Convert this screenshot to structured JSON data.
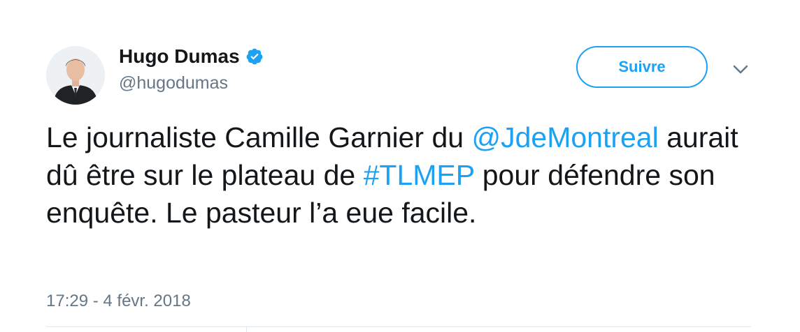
{
  "author": {
    "display_name": "Hugo Dumas",
    "handle": "@hugodumas",
    "verified": true,
    "avatar_icon": "profile-photo"
  },
  "follow_button": {
    "label": "Suivre"
  },
  "menu_icon": "chevron-down-icon",
  "tweet": {
    "segments": [
      {
        "text": "Le journaliste Camille Garnier du ",
        "type": "text"
      },
      {
        "text": "@JdeMontreal",
        "type": "mention"
      },
      {
        "text": " aurait dû être sur le plateau de ",
        "type": "text"
      },
      {
        "text": "#TLMEP",
        "type": "hashtag"
      },
      {
        "text": " pour défendre son enquête. Le pasteur l’a eue facile.",
        "type": "text"
      }
    ]
  },
  "timestamp": "17:29 - 4 févr. 2018",
  "colors": {
    "accent": "#1da1f2",
    "text": "#14171a",
    "secondary": "#657786"
  }
}
